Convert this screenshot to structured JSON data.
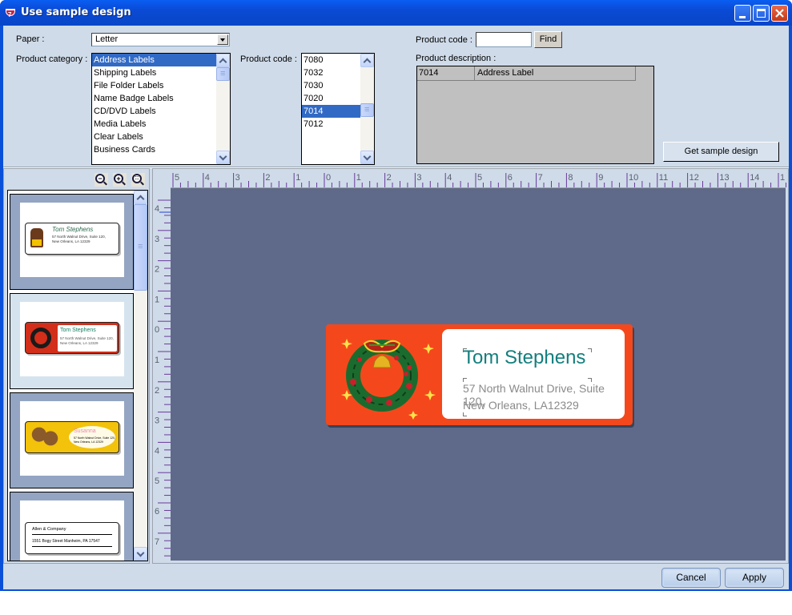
{
  "window": {
    "title": "Use sample design",
    "controls": [
      "minimize",
      "maximize",
      "close"
    ]
  },
  "form": {
    "paper_label": "Paper :",
    "paper_value": "Letter",
    "category_label": "Product category :",
    "categories": [
      {
        "label": "Address Labels",
        "selected": true
      },
      {
        "label": "Shipping Labels",
        "selected": false
      },
      {
        "label": "File Folder Labels",
        "selected": false
      },
      {
        "label": "Name Badge Labels",
        "selected": false
      },
      {
        "label": "CD/DVD Labels",
        "selected": false
      },
      {
        "label": "Media Labels",
        "selected": false
      },
      {
        "label": "Clear Labels",
        "selected": false
      },
      {
        "label": "Business Cards",
        "selected": false
      }
    ],
    "code_list_label": "Product code :",
    "codes": [
      {
        "label": "7080",
        "selected": false
      },
      {
        "label": "7032",
        "selected": false
      },
      {
        "label": "7030",
        "selected": false
      },
      {
        "label": "7020",
        "selected": false
      },
      {
        "label": "7014",
        "selected": true
      },
      {
        "label": "7012",
        "selected": false
      }
    ],
    "search_label": "Product code :",
    "search_value": "",
    "find_button": "Find",
    "description_label": "Product description :",
    "description_rows": [
      {
        "code": "7014",
        "description": "Address Label"
      }
    ],
    "get_sample_button": "Get sample design"
  },
  "thumbnails": [
    {
      "name": "Tom Stephens",
      "line1": "57 North Walnut Drive, Suite 120,",
      "line2": "New Orleans, LA 12329",
      "theme": "bear",
      "selected": false
    },
    {
      "name": "Tom Stephens",
      "line1": "57 North Walnut Drive, Suite 120,",
      "line2": "New Orleans, LA 12329",
      "theme": "wreath",
      "selected": true
    },
    {
      "name": "Susanna",
      "line1": "57 North Walnut Drive, Suite 120,",
      "line2": "New Orleans, LA 12329",
      "theme": "yellow",
      "selected": false
    },
    {
      "name": "Allen & Company",
      "line1": "1551 Bogy Street Manheim, PA 17547",
      "line2": "",
      "theme": "plain",
      "selected": false
    }
  ],
  "zoom_tools": [
    "zoom-out",
    "zoom-in",
    "zoom-fit"
  ],
  "ruler": {
    "horizontal_labels": [
      "5",
      "4",
      "3",
      "2",
      "1",
      "0",
      "1",
      "2",
      "3",
      "4",
      "5",
      "6",
      "7",
      "8",
      "9",
      "10",
      "11",
      "12",
      "13",
      "14",
      "1"
    ],
    "vertical_labels": [
      "4",
      "3",
      "2",
      "1",
      "0",
      "1",
      "2",
      "3",
      "4",
      "5",
      "6",
      "7"
    ]
  },
  "preview": {
    "name": "Tom Stephens",
    "address_line1": "57 North Walnut Drive, Suite 120,",
    "address_line2": "New Orleans, LA12329",
    "background_color": "#f4481c",
    "name_color": "#137f7d"
  },
  "footer": {
    "cancel": "Cancel",
    "apply": "Apply"
  }
}
